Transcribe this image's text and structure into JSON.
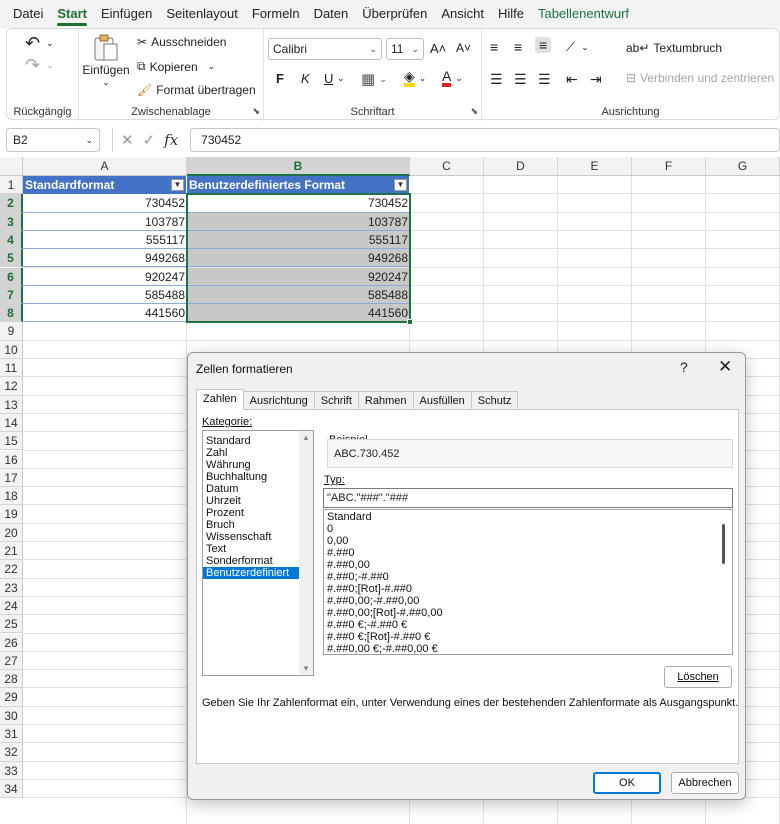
{
  "menu": [
    "Datei",
    "Start",
    "Einfügen",
    "Seitenlayout",
    "Formeln",
    "Daten",
    "Überprüfen",
    "Ansicht",
    "Hilfe",
    "Tabellenentwurf"
  ],
  "ribbon": {
    "undo_group": "Rückgängig",
    "clipboard": {
      "label": "Zwischenablage",
      "paste": "Einfügen",
      "cut": "Ausschneiden",
      "copy": "Kopieren",
      "format_painter": "Format übertragen"
    },
    "font": {
      "label": "Schriftart",
      "name": "Calibri",
      "size": "11",
      "bold": "F",
      "italic": "K",
      "underline": "U"
    },
    "alignment": {
      "label": "Ausrichtung",
      "wrap": "Textumbruch",
      "merge": "Verbinden und zentrieren"
    }
  },
  "formula_bar": {
    "name_box": "B2",
    "fx": "fx",
    "value": "730452"
  },
  "sheet": {
    "columns": [
      "A",
      "B",
      "C",
      "D",
      "E",
      "F",
      "G"
    ],
    "rows": [
      "1",
      "2",
      "3",
      "4",
      "5",
      "6",
      "7",
      "8",
      "9",
      "10",
      "11",
      "12",
      "13",
      "14",
      "15",
      "16",
      "17",
      "18",
      "19",
      "20",
      "21",
      "22",
      "23",
      "24",
      "25",
      "26",
      "27",
      "28",
      "29",
      "30",
      "31",
      "32",
      "33",
      "34"
    ],
    "header": [
      "Standardformat",
      "Benutzerdefiniertes Format"
    ],
    "values_a": [
      "730452",
      "103787",
      "555117",
      "949268",
      "920247",
      "585488",
      "441560"
    ],
    "values_b": [
      "730452",
      "103787",
      "555117",
      "949268",
      "920247",
      "585488",
      "441560"
    ]
  },
  "dialog": {
    "title": "Zellen formatieren",
    "help": "?",
    "close": "✕",
    "tabs": [
      "Zahlen",
      "Ausrichtung",
      "Schrift",
      "Rahmen",
      "Ausfüllen",
      "Schutz"
    ],
    "category_label": "Kategorie:",
    "categories": [
      "Standard",
      "Zahl",
      "Währung",
      "Buchhaltung",
      "Datum",
      "Uhrzeit",
      "Prozent",
      "Bruch",
      "Wissenschaft",
      "Text",
      "Sonderformat",
      "Benutzerdefiniert"
    ],
    "selected_category": "Benutzerdefiniert",
    "sample_label": "Beispiel",
    "sample_value": "ABC.730.452",
    "type_label": "Typ:",
    "type_value": "\"ABC.\"###\".\"###",
    "formats": [
      "Standard",
      "0",
      "0,00",
      "#.##0",
      "#.##0,00",
      "#.##0;-#.##0",
      "#.##0;[Rot]-#.##0",
      "#.##0,00;-#.##0,00",
      "#.##0,00;[Rot]-#.##0,00",
      "#.##0 €;-#.##0 €",
      "#.##0 €;[Rot]-#.##0 €",
      "#.##0,00 €;-#.##0,00 €"
    ],
    "delete": "Löschen",
    "hint": "Geben Sie Ihr Zahlenformat ein, unter Verwendung eines der bestehenden Zahlenformate als Ausgangspunkt.",
    "ok": "OK",
    "cancel": "Abbrechen"
  },
  "colors": {
    "accent": "#1e7145",
    "table_header": "#4472c4",
    "selection_fill": "#c8c8c8",
    "dialog_select": "#0078d7"
  }
}
